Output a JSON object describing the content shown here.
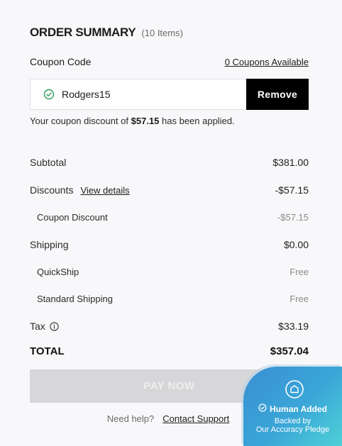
{
  "summary": {
    "title": "ORDER SUMMARY",
    "item_count": "(10 Items)"
  },
  "coupon": {
    "label": "Coupon Code",
    "available_link": "0 Coupons Available",
    "code": "Rodgers15",
    "remove_label": "Remove",
    "msg_prefix": "Your coupon discount of ",
    "msg_amount": "$57.15",
    "msg_suffix": " has been applied."
  },
  "lines": {
    "subtotal": {
      "label": "Subtotal",
      "value": "$381.00"
    },
    "discounts": {
      "label": "Discounts",
      "link": "View details",
      "value": "-$57.15"
    },
    "coupon_discount": {
      "label": "Coupon Discount",
      "value": "-$57.15"
    },
    "shipping": {
      "label": "Shipping",
      "value": "$0.00"
    },
    "quickship": {
      "label": "QuickShip",
      "value": "Free"
    },
    "standard_shipping": {
      "label": "Standard Shipping",
      "value": "Free"
    },
    "tax": {
      "label": "Tax",
      "value": "$33.19"
    },
    "total": {
      "label": "TOTAL",
      "value": "$357.04"
    }
  },
  "pay_button": {
    "label": "PAY NOW"
  },
  "help": {
    "question": "Need help?",
    "link": "Contact Support"
  },
  "badge": {
    "title": "Human Added",
    "sub1": "Backed by",
    "sub2": "Our Accuracy Pledge"
  },
  "colors": {
    "background": "#f8f8fa",
    "remove_button": "#000000",
    "pay_button_disabled": "#d7d7d9",
    "check_green": "#2e9a5a",
    "badge_gradient_start": "#3a8fd1",
    "badge_gradient_end": "#4fd1d6"
  },
  "icons": {
    "coupon_status": "check-circle-icon",
    "tax_info": "info-icon",
    "badge": "shield-icon",
    "badge_check": "check-circle-icon"
  }
}
